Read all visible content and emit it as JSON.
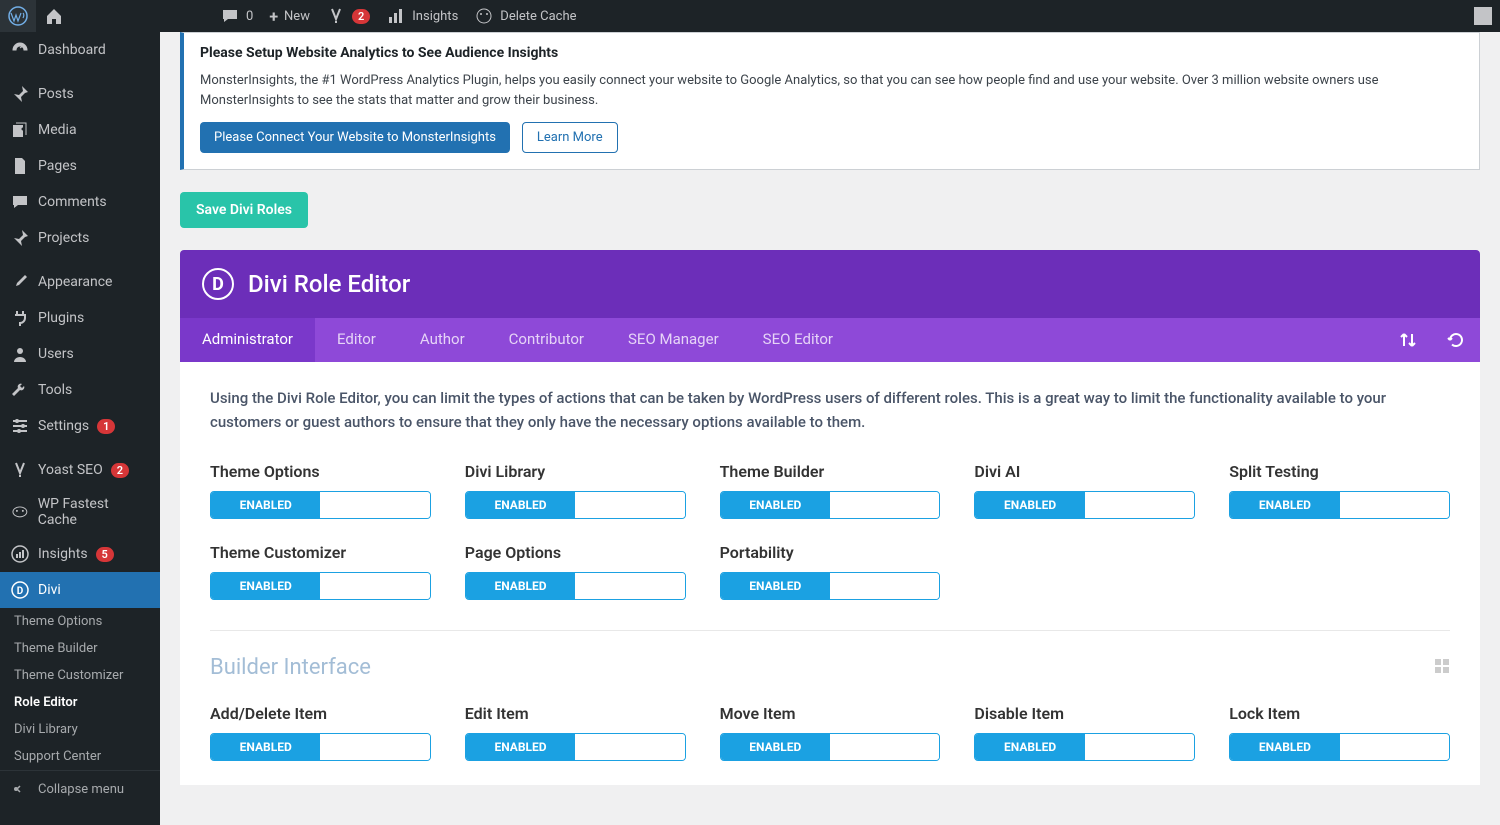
{
  "topbar": {
    "comments_count": "0",
    "new_label": "New",
    "yoast_badge": "2",
    "insights_label": "Insights",
    "delete_cache_label": "Delete Cache"
  },
  "sidebar": {
    "items": [
      {
        "label": "Dashboard",
        "icon": "gauge"
      },
      {
        "label": "Posts",
        "icon": "pin"
      },
      {
        "label": "Media",
        "icon": "media"
      },
      {
        "label": "Pages",
        "icon": "page"
      },
      {
        "label": "Comments",
        "icon": "comment"
      },
      {
        "label": "Projects",
        "icon": "pin"
      },
      {
        "label": "Appearance",
        "icon": "brush"
      },
      {
        "label": "Plugins",
        "icon": "plug"
      },
      {
        "label": "Users",
        "icon": "user"
      },
      {
        "label": "Tools",
        "icon": "wrench"
      },
      {
        "label": "Settings",
        "icon": "sliders",
        "badge": "1"
      },
      {
        "label": "Yoast SEO",
        "icon": "yoast",
        "badge": "2"
      },
      {
        "label": "WP Fastest Cache",
        "icon": "cheetah"
      },
      {
        "label": "Insights",
        "icon": "insights",
        "badge": "5"
      },
      {
        "label": "Divi",
        "icon": "divi",
        "active": true
      }
    ],
    "divi_sub": [
      {
        "label": "Theme Options"
      },
      {
        "label": "Theme Builder"
      },
      {
        "label": "Theme Customizer"
      },
      {
        "label": "Role Editor",
        "current": true
      },
      {
        "label": "Divi Library"
      },
      {
        "label": "Support Center"
      }
    ],
    "collapse": "Collapse menu"
  },
  "notice": {
    "title": "Please Setup Website Analytics to See Audience Insights",
    "body": "MonsterInsights, the #1 WordPress Analytics Plugin, helps you easily connect your website to Google Analytics, so that you can see how people find and use your website. Over 3 million website owners use MonsterInsights to see the stats that matter and grow their business.",
    "primary_btn": "Please Connect Your Website to MonsterInsights",
    "secondary_btn": "Learn More"
  },
  "save_btn": "Save Divi Roles",
  "panel": {
    "title": "Divi Role Editor"
  },
  "tabs": [
    "Administrator",
    "Editor",
    "Author",
    "Contributor",
    "SEO Manager",
    "SEO Editor"
  ],
  "active_tab": 0,
  "description": "Using the Divi Role Editor, you can limit the types of actions that can be taken by WordPress users of different roles. This is a great way to limit the functionality available to your customers or guest authors to ensure that they only have the necessary options available to them.",
  "enabled_label": "ENABLED",
  "top_section_toggles": [
    "Theme Options",
    "Divi Library",
    "Theme Builder",
    "Divi AI",
    "Split Testing",
    "Theme Customizer",
    "Page Options",
    "Portability"
  ],
  "builder_section": {
    "title": "Builder Interface",
    "toggles": [
      "Add/Delete Item",
      "Edit Item",
      "Move Item",
      "Disable Item",
      "Lock Item"
    ]
  }
}
